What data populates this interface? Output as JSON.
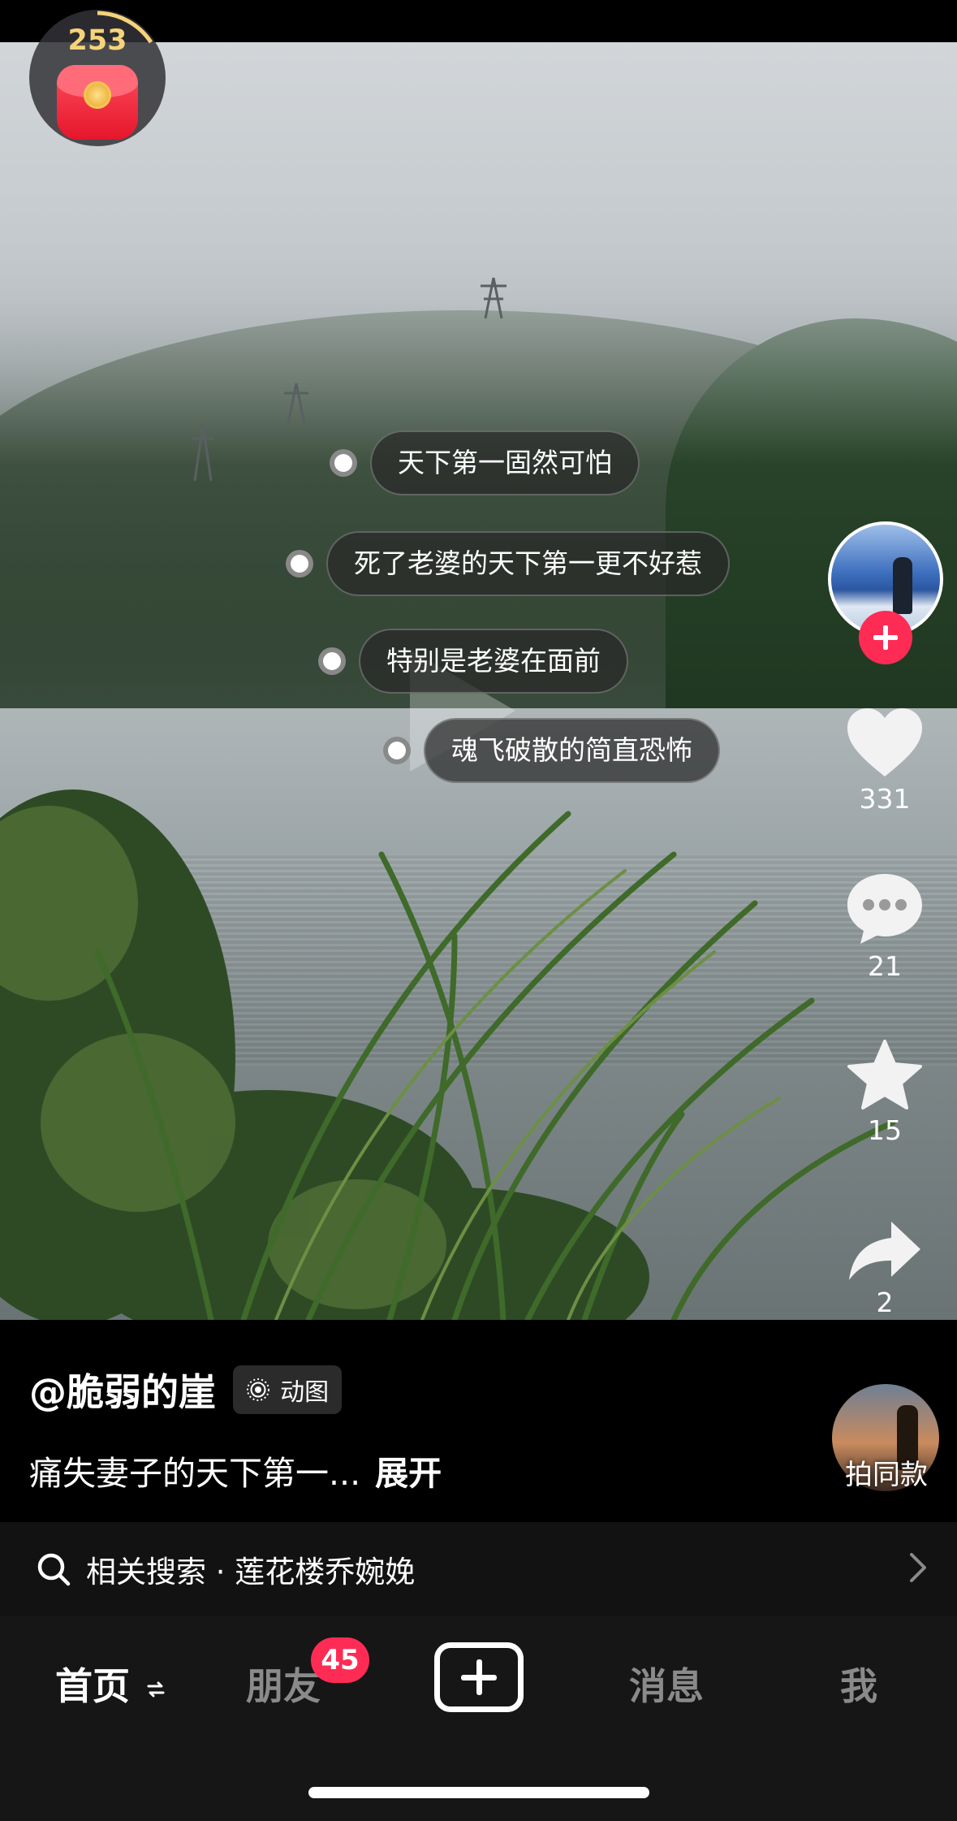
{
  "reward_widget": {
    "count": "253",
    "icon": "red-packet-icon"
  },
  "video": {
    "danmaku": [
      "天下第一固然可怕",
      "死了老婆的天下第一更不好惹",
      "特别是老婆在面前",
      "魂飞破散的简直恐怖"
    ]
  },
  "actions": {
    "follow_icon": "plus-icon",
    "like": {
      "icon": "heart-icon",
      "count": "331"
    },
    "comment": {
      "icon": "comment-icon",
      "count": "21"
    },
    "favorite": {
      "icon": "star-icon",
      "count": "15"
    },
    "share": {
      "icon": "share-icon",
      "count": "2"
    }
  },
  "post": {
    "author": "@脆弱的崖",
    "tag": "动图",
    "description": "痛失妻子的天下第一...",
    "expand_label": "展开",
    "same_style_label": "拍同款"
  },
  "related_search": {
    "text": "相关搜索 · 莲花楼乔婉娩"
  },
  "tabbar": {
    "home": "首页",
    "friends": "朋友",
    "friends_badge": "45",
    "messages": "消息",
    "me": "我"
  },
  "colors": {
    "accent": "#fe2c55",
    "background": "#000000",
    "tabbar": "#161616"
  }
}
